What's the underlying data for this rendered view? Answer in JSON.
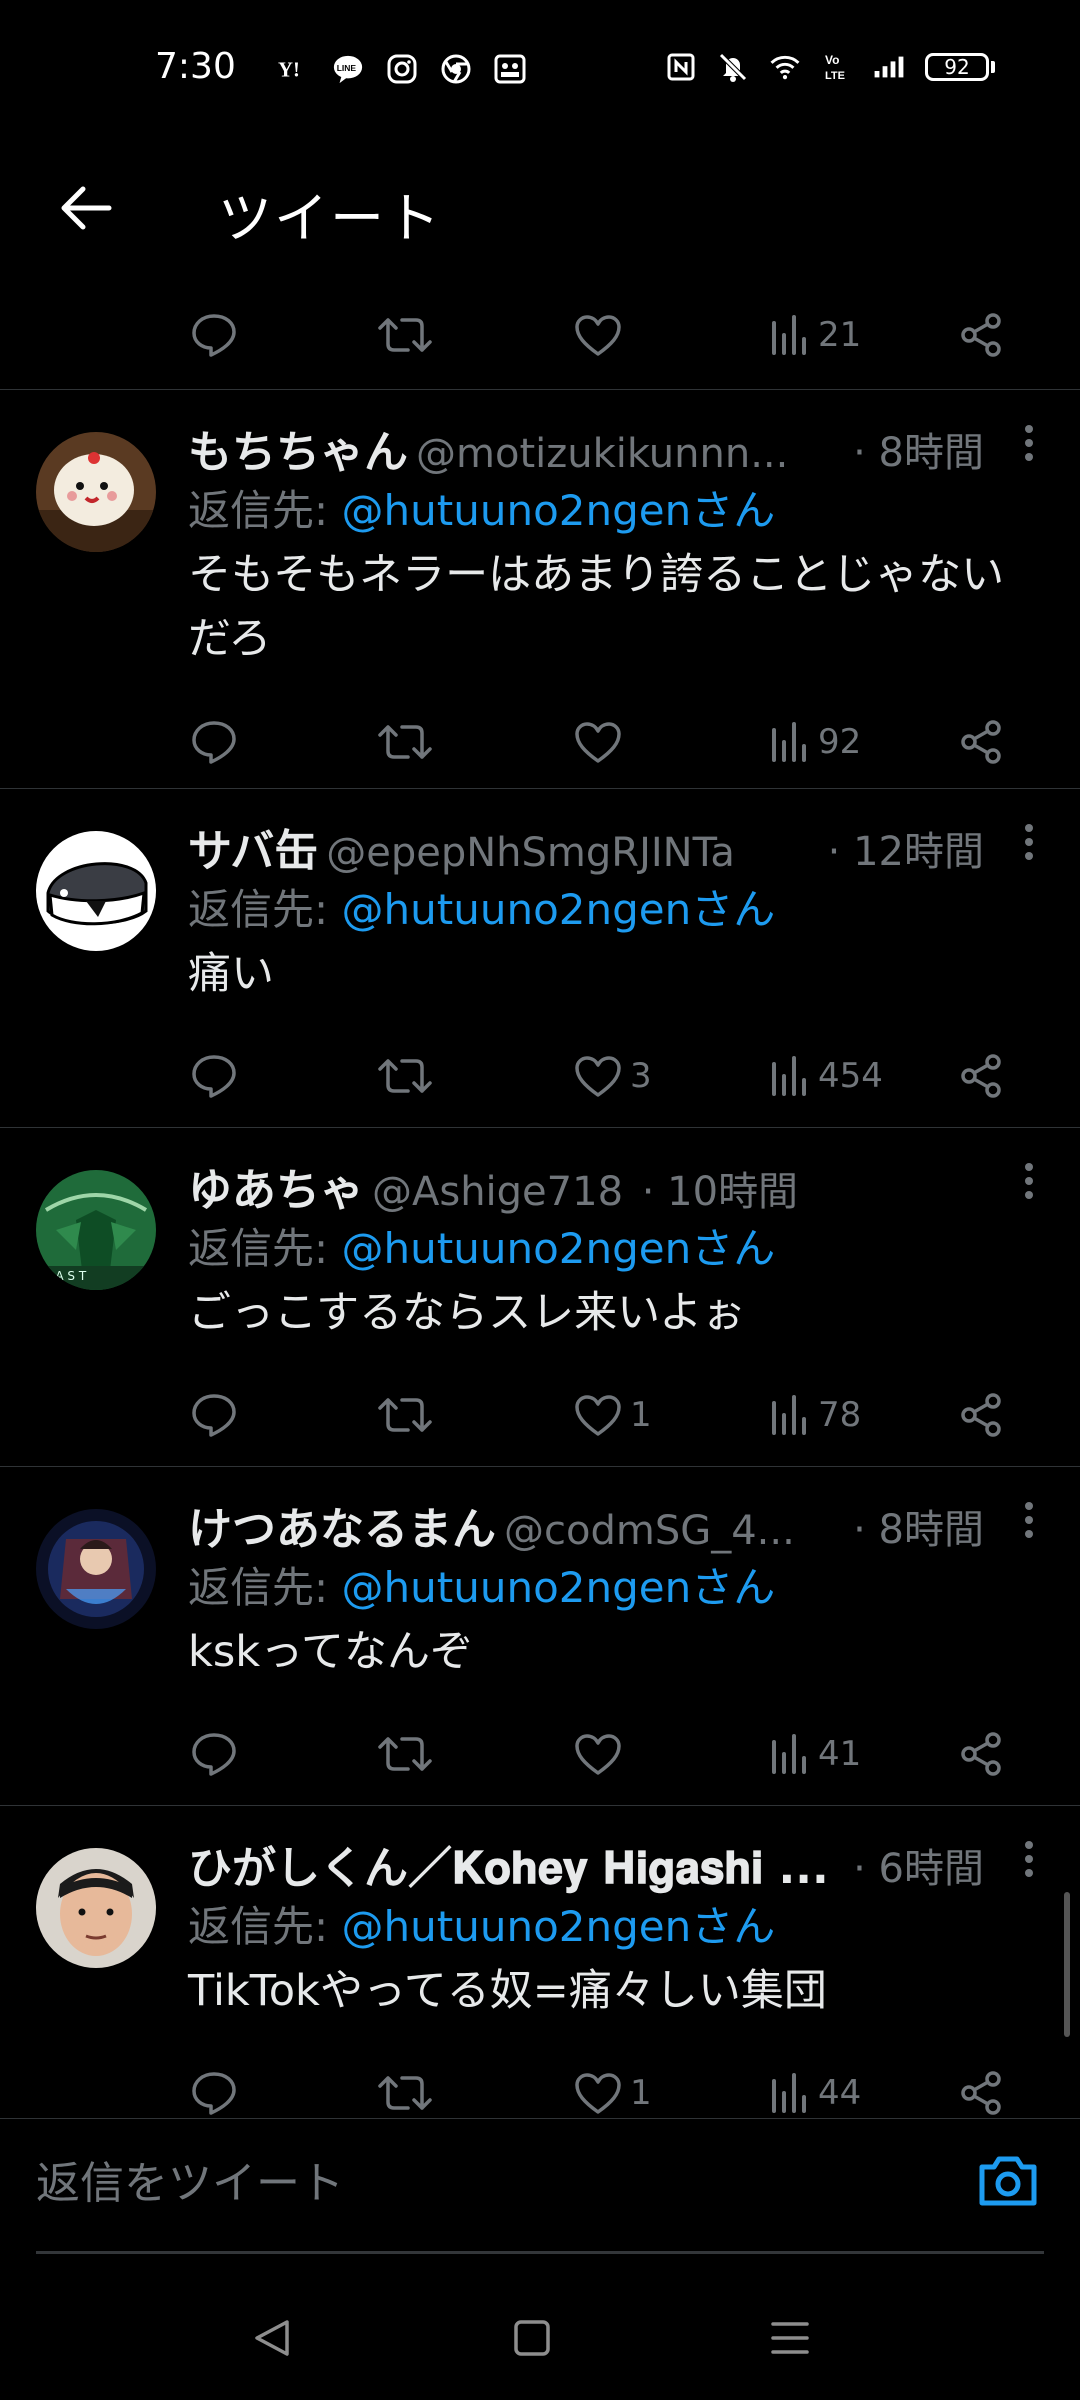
{
  "status": {
    "time": "7:30",
    "left_icons": [
      "yahoo-icon",
      "line-icon",
      "instagram-icon",
      "chrome-icon",
      "gallery-icon"
    ],
    "right_icons": [
      "nfc-icon",
      "mute-icon",
      "wifi-icon",
      "volte-icon",
      "signal-icon"
    ],
    "battery": "92"
  },
  "header": {
    "title": "ツイート"
  },
  "first_row": {
    "views": "21"
  },
  "tweets": [
    {
      "name": "もちちゃん",
      "handle": "@motizukikunnn...",
      "time": "· 8時間",
      "reply_prefix": "返信先:",
      "reply_to": "@hutuuno2ngenさん",
      "text": "そもそもネラーはあまり誇ることじゃないだろ",
      "likes": "",
      "views": "92"
    },
    {
      "name": "サバ缶",
      "handle": "@epepNhSmgRJINTa",
      "time": "· 12時間",
      "reply_prefix": "返信先:",
      "reply_to": "@hutuuno2ngenさん",
      "text": "痛い",
      "likes": "3",
      "views": "454"
    },
    {
      "name": "ゆあちゃ",
      "handle": "@Ashige718",
      "time": "· 10時間",
      "reply_prefix": "返信先:",
      "reply_to": "@hutuuno2ngenさん",
      "text": "ごっこするならスレ来いよぉ",
      "likes": "1",
      "views": "78"
    },
    {
      "name": "けつあなるまん",
      "handle": "@codmSG_4...",
      "time": "· 8時間",
      "reply_prefix": "返信先:",
      "reply_to": "@hutuuno2ngenさん",
      "text": "kskってなんぞ",
      "likes": "",
      "views": "41"
    },
    {
      "name": "ひがしくん／𝐊𝐨𝐡𝐞𝐲 𝐇𝐢𝐠𝐚𝐬𝐡𝐢 ...",
      "handle": "",
      "time": "· 6時間",
      "reply_prefix": "返信先:",
      "reply_to": "@hutuuno2ngenさん",
      "text": "TikTokやってる奴=痛々しい集団",
      "likes": "1",
      "views": "44"
    }
  ],
  "composer": {
    "placeholder": "返信をツイート"
  },
  "colors": {
    "background": "#000000",
    "accent": "#1d9bf0",
    "muted": "#71767b",
    "text": "#e7e9ea"
  }
}
